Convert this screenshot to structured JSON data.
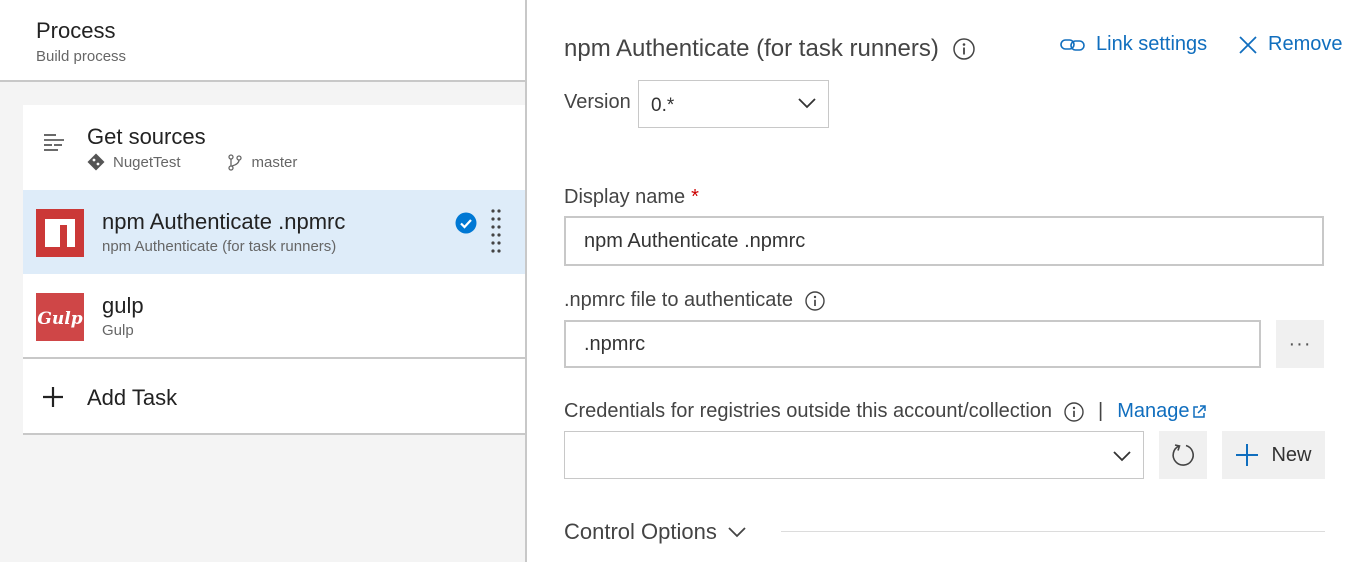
{
  "process": {
    "title": "Process",
    "subtitle": "Build process"
  },
  "tasks": {
    "get_sources": {
      "title": "Get sources",
      "repo": "NugetTest",
      "branch": "master"
    },
    "npm": {
      "title": "npm Authenticate .npmrc",
      "subtitle": "npm Authenticate (for task runners)"
    },
    "gulp": {
      "title": "gulp",
      "subtitle": "Gulp"
    },
    "add_task": {
      "label": "Add Task"
    }
  },
  "detail": {
    "title": "npm Authenticate (for task runners)",
    "link_settings": "Link settings",
    "remove": "Remove",
    "version_label": "Version",
    "version_value": "0.*",
    "display_name_label": "Display name",
    "display_name_required": "*",
    "display_name_value": "npm Authenticate .npmrc",
    "npmrc_label": ".npmrc file to authenticate",
    "npmrc_value": ".npmrc",
    "browse_label": "···",
    "credentials_label": "Credentials for registries outside this account/collection",
    "separator": "|",
    "manage": "Manage",
    "credentials_value": "",
    "new_label": "New",
    "control_options": "Control Options"
  },
  "colors": {
    "accent": "#106ebe",
    "selected_bg": "#deecf9",
    "npm_red": "#cb3837",
    "gulp_red": "#cf4647"
  },
  "icons": [
    "lines-icon",
    "git-icon",
    "branch-icon",
    "npm-logo-icon",
    "check-circle-icon",
    "drag-handle-icon",
    "gulp-logo-icon",
    "plus-icon",
    "info-icon",
    "link-icon",
    "close-icon",
    "chevron-down-icon",
    "external-link-icon",
    "refresh-icon"
  ]
}
